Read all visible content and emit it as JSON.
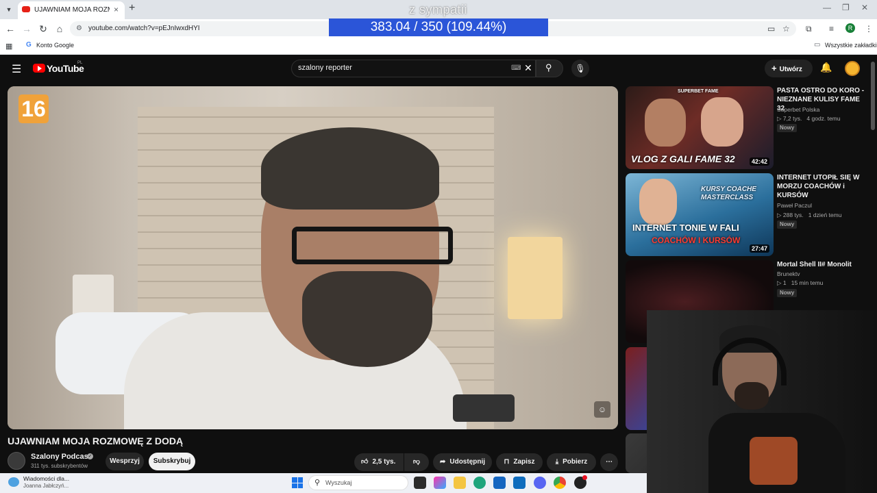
{
  "browser": {
    "tab_title": "UJAWNIAM MOJA ROZMOWĘ Z DODĄ",
    "url": "youtube.com/watch?v=pEJnIwxdHYI",
    "bookmark_google": "Konto Google",
    "bookmark_all": "Wszystkie zakładki",
    "profile_initial": "R"
  },
  "overlay": {
    "banner_text": "z sympatii",
    "counter_text": "383.04 / 350 (109.44%)",
    "counter_color": "#2b55d8"
  },
  "youtube": {
    "logo_text": "YouTube",
    "logo_region": "PL",
    "search_value": "szalony reporter",
    "create_label": "Utwórz"
  },
  "video": {
    "age_rating": "16",
    "title": "UJAWNIAM MOJA ROZMOWĘ Z DODĄ",
    "channel_name": "Szalony Podcast",
    "channel_subs": "311 tys. subskrybentów",
    "support_label": "Wesprzyj",
    "subscribe_label": "Subskrybuj",
    "likes": "2,5 tys.",
    "share_label": "Udostępnij",
    "save_label": "Zapisz",
    "download_label": "Pobierz"
  },
  "recommendations": [
    {
      "title": "PASTA OSTRO DO KORO - NIEZNANE KULISY FAME 32",
      "channel": "Superbet Polska",
      "views": "7,2 tys.",
      "age": "4 godz. temu",
      "badge": "Nowy",
      "duration": "42:42",
      "caption": "VLOG Z GALI FAME 32",
      "thumb_top_text": "SUPERBET FAME"
    },
    {
      "title": "INTERNET UTOPIŁ SIĘ W MORZU COACHÓW i KURSÓW",
      "channel": "Paweł Paczul",
      "views": "288 tys.",
      "age": "1 dzień temu",
      "badge": "Nowy",
      "duration": "27:47",
      "caption_line1": "INTERNET TONIE W FALI",
      "caption_line2": "COACHÓW I KURSÓW",
      "thumb_words": "KURSY COACHE MASTERCLASS"
    },
    {
      "title": "Mortal Shell II# Monolit",
      "channel": "Brunektv",
      "views": "1",
      "age": "15 min temu",
      "badge": "Nowy"
    }
  ],
  "taskbar": {
    "notification_title": "Wiadomości dla...",
    "notification_sub": "Joanna Jabłczyń...",
    "search_placeholder": "Wyszukaj"
  }
}
